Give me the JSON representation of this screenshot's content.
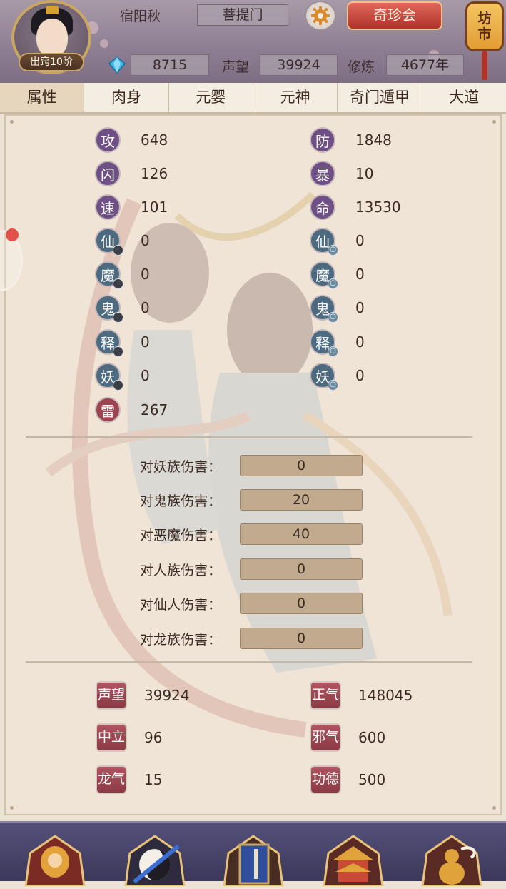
{
  "header": {
    "rank_badge": "出窍10阶",
    "player_name": "宿阳秋",
    "sect": "菩提门",
    "treasure_button": "奇珍会",
    "market_line1": "坊",
    "market_line2": "市",
    "gems": "8715",
    "reputation_label": "声望",
    "reputation_value": "39924",
    "cultivation_label": "修炼",
    "cultivation_value": "4677年"
  },
  "tabs": [
    "属性",
    "肉身",
    "元婴",
    "元神",
    "奇门遁甲",
    "大道"
  ],
  "active_tab": 0,
  "stats_left": [
    {
      "icon": "攻",
      "value": "648"
    },
    {
      "icon": "闪",
      "value": "126"
    },
    {
      "icon": "速",
      "value": "101"
    },
    {
      "icon": "仙",
      "value": "0"
    },
    {
      "icon": "魔",
      "value": "0"
    },
    {
      "icon": "鬼",
      "value": "0"
    },
    {
      "icon": "释",
      "value": "0"
    },
    {
      "icon": "妖",
      "value": "0"
    },
    {
      "icon": "雷",
      "value": "267"
    }
  ],
  "stats_right": [
    {
      "icon": "防",
      "value": "1848"
    },
    {
      "icon": "暴",
      "value": "10"
    },
    {
      "icon": "命",
      "value": "13530"
    },
    {
      "icon": "仙",
      "value": "0"
    },
    {
      "icon": "魔",
      "value": "0"
    },
    {
      "icon": "鬼",
      "value": "0"
    },
    {
      "icon": "释",
      "value": "0"
    },
    {
      "icon": "妖",
      "value": "0"
    }
  ],
  "damage": [
    {
      "label": "对妖族伤害：",
      "value": "0"
    },
    {
      "label": "对鬼族伤害：",
      "value": "20"
    },
    {
      "label": "对恶魔伤害：",
      "value": "40"
    },
    {
      "label": "对人族伤害：",
      "value": "0"
    },
    {
      "label": "对仙人伤害：",
      "value": "0"
    },
    {
      "label": "对龙族伤害：",
      "value": "0"
    }
  ],
  "reputation_stats": [
    {
      "label": "声望",
      "value": "39924"
    },
    {
      "label": "正气",
      "value": "148045"
    },
    {
      "label": "中立",
      "value": "96"
    },
    {
      "label": "邪气",
      "value": "600"
    },
    {
      "label": "龙气",
      "value": "15"
    },
    {
      "label": "功德",
      "value": "500"
    }
  ],
  "colors": {
    "accent_red": "#b0322b",
    "panel_bg": "#efe4d6",
    "header_bg": "#8f8094"
  }
}
